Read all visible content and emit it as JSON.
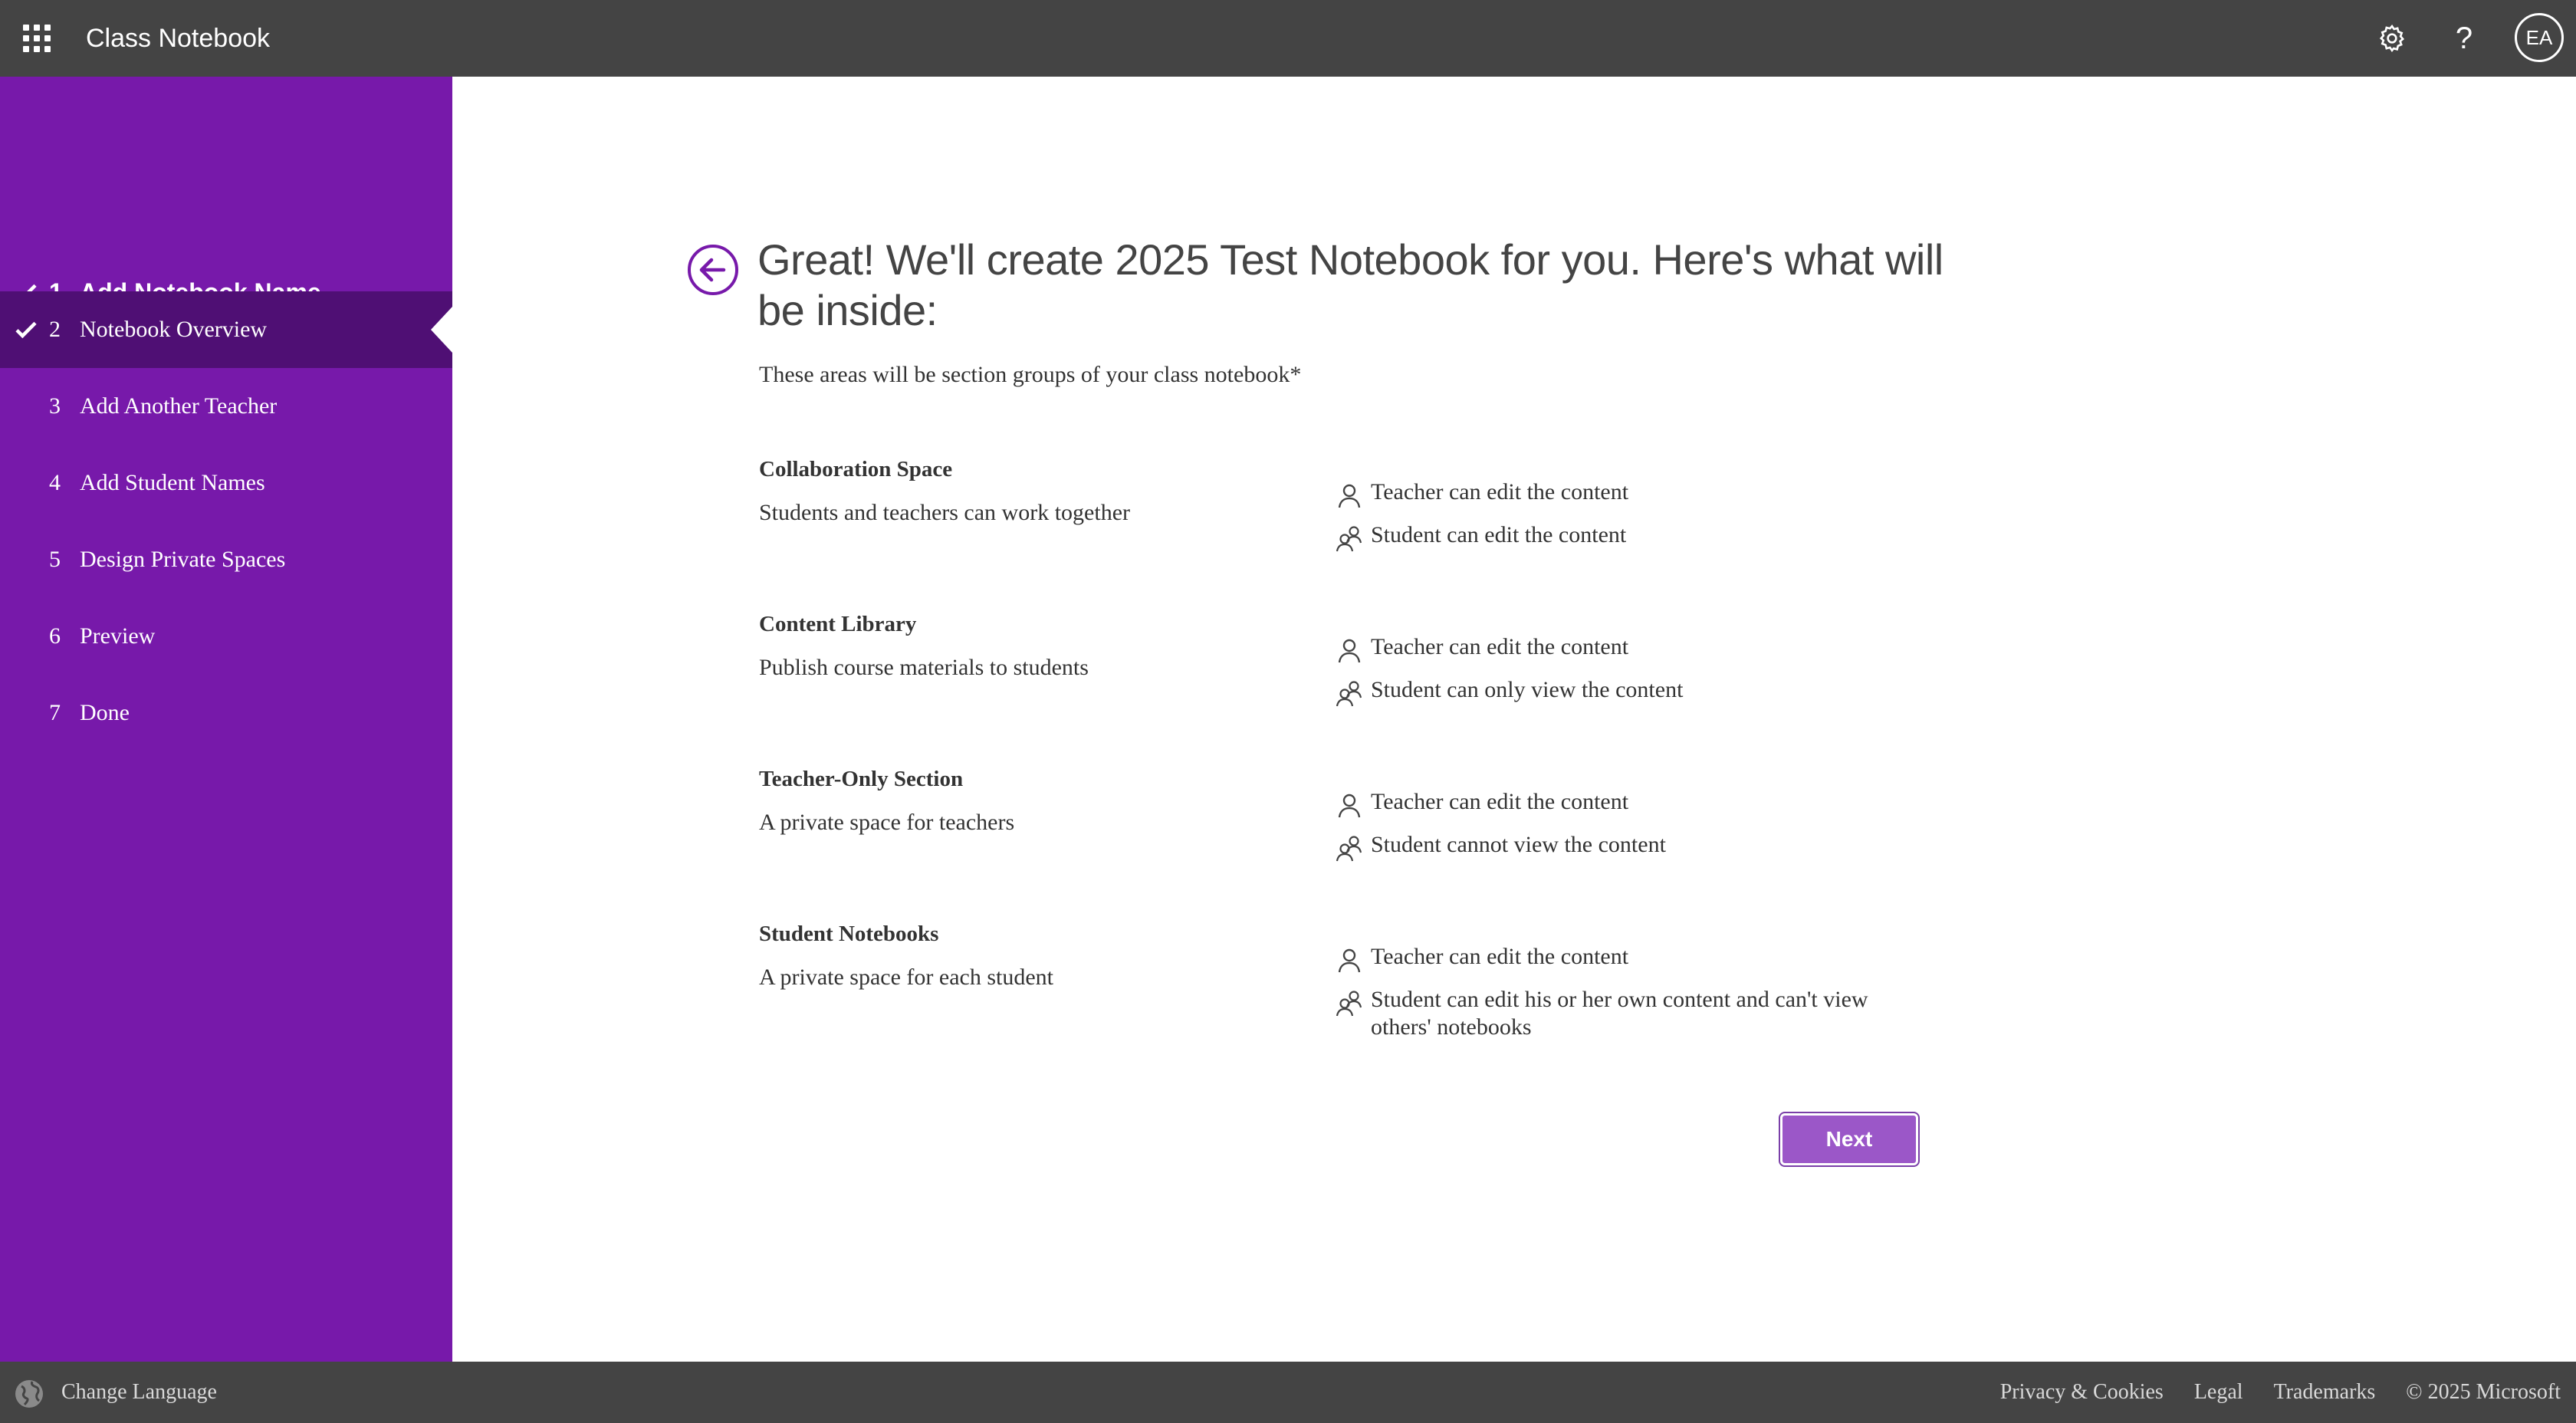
{
  "header": {
    "app_title": "Class Notebook",
    "help_label": "?",
    "avatar_initials": "EA"
  },
  "sidebar": {
    "steps": [
      {
        "num": "1",
        "label": "Add Notebook Name",
        "completed": true
      },
      {
        "num": "2",
        "label": "Notebook Overview",
        "completed": true,
        "active": true
      },
      {
        "num": "3",
        "label": "Add Another Teacher"
      },
      {
        "num": "4",
        "label": "Add Student Names"
      },
      {
        "num": "5",
        "label": "Design Private Spaces"
      },
      {
        "num": "6",
        "label": "Preview"
      },
      {
        "num": "7",
        "label": "Done"
      }
    ]
  },
  "main": {
    "headline": "Great! We'll create 2025 Test Notebook for you. Here's what will be inside:",
    "subtitle": "These areas will be section groups of your class notebook*",
    "areas": [
      {
        "title": "Collaboration Space",
        "description": "Students and teachers can work together",
        "teacher_perm": "Teacher can edit the content",
        "student_perm": "Student can edit the content"
      },
      {
        "title": "Content Library",
        "description": "Publish course materials to students",
        "teacher_perm": "Teacher can edit the content",
        "student_perm": "Student can only view the content"
      },
      {
        "title": "Teacher-Only Section",
        "description": "A private space for teachers",
        "teacher_perm": "Teacher can edit the content",
        "student_perm": "Student cannot view the content"
      },
      {
        "title": "Student Notebooks",
        "description": "A private space for each student",
        "teacher_perm": "Teacher can edit the content",
        "student_perm": "Student can edit his or her own content and can't view others' notebooks"
      }
    ],
    "next_label": "Next"
  },
  "footer": {
    "change_language": "Change Language",
    "links": [
      "Privacy & Cookies",
      "Legal",
      "Trademarks",
      "© 2025 Microsoft"
    ]
  },
  "colors": {
    "sidebar": "#7719aa",
    "sidebar_active": "#4f0f74",
    "topbar": "#444444",
    "accent": "#7719aa",
    "next_button": "#9b57c8"
  },
  "icons": [
    "app-launcher-icon",
    "gear-icon",
    "help-icon",
    "checkmark-icon",
    "back-arrow-icon",
    "person-icon",
    "people-icon",
    "globe-icon"
  ]
}
